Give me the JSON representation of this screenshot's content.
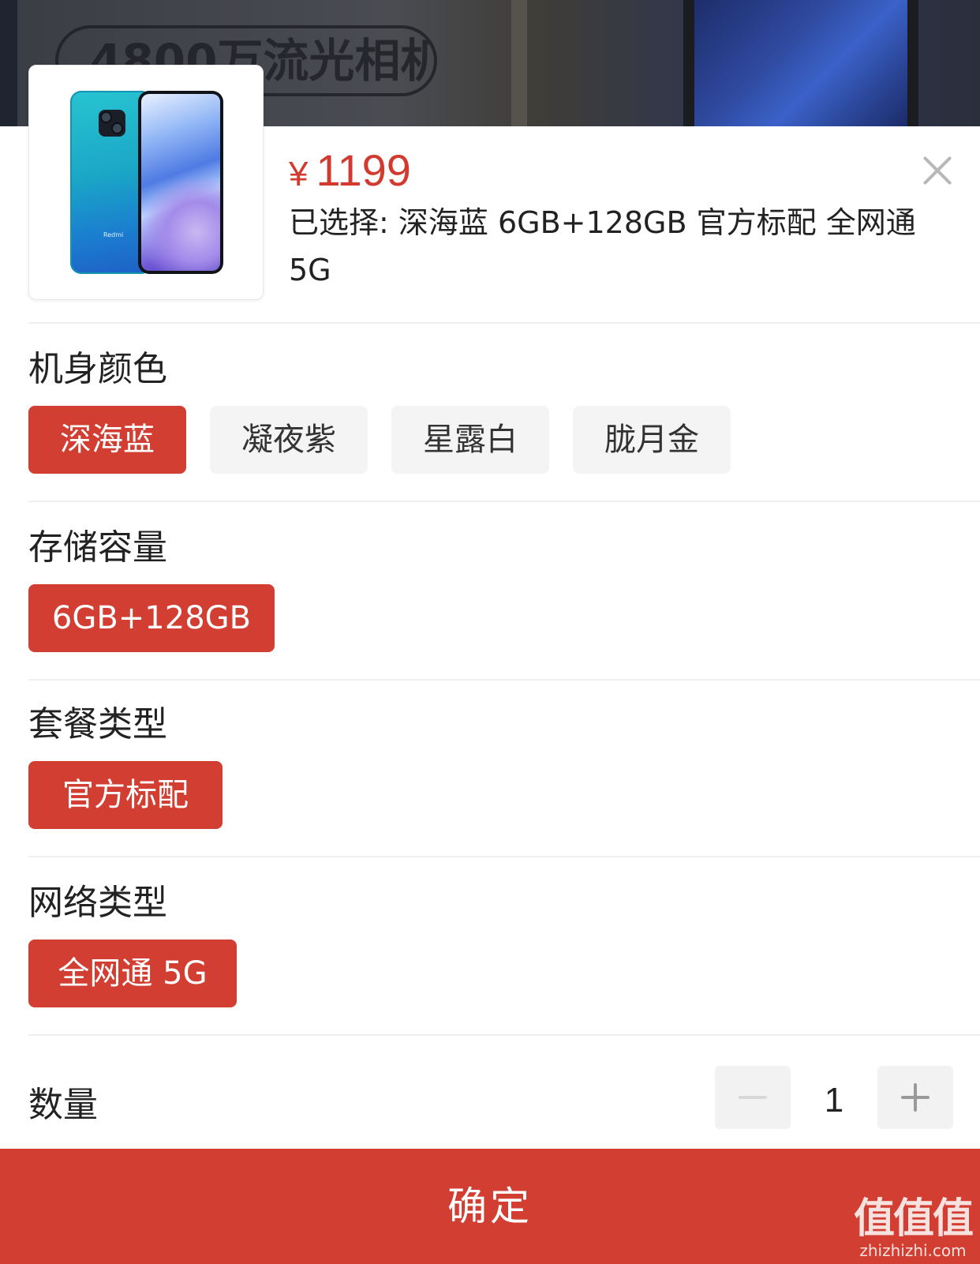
{
  "backdrop": {
    "pill_text": "4800万流光相机"
  },
  "product": {
    "brand": "Redmi",
    "price_currency": "¥",
    "price": "1199",
    "selected_text": "已选择: 深海蓝 6GB+128GB 官方标配 全网通 5G"
  },
  "sections": {
    "color": {
      "title": "机身颜色",
      "options": [
        "深海蓝",
        "凝夜紫",
        "星露白",
        "胧月金"
      ],
      "selected": "深海蓝"
    },
    "storage": {
      "title": "存储容量",
      "options": [
        "6GB+128GB"
      ],
      "selected": "6GB+128GB"
    },
    "package": {
      "title": "套餐类型",
      "options": [
        "官方标配"
      ],
      "selected": "官方标配"
    },
    "network": {
      "title": "网络类型",
      "options": [
        "全网通 5G"
      ],
      "selected": "全网通 5G"
    }
  },
  "quantity": {
    "label": "数量",
    "value": "1"
  },
  "confirm_label": "确定",
  "watermark": {
    "big": "值值值",
    "small": "zhizhizhi.com"
  },
  "colors": {
    "accent": "#d23e31",
    "price": "#d23a2f",
    "option_bg": "#f4f4f4"
  },
  "icons": [
    "close-icon",
    "minus-icon",
    "plus-icon"
  ]
}
